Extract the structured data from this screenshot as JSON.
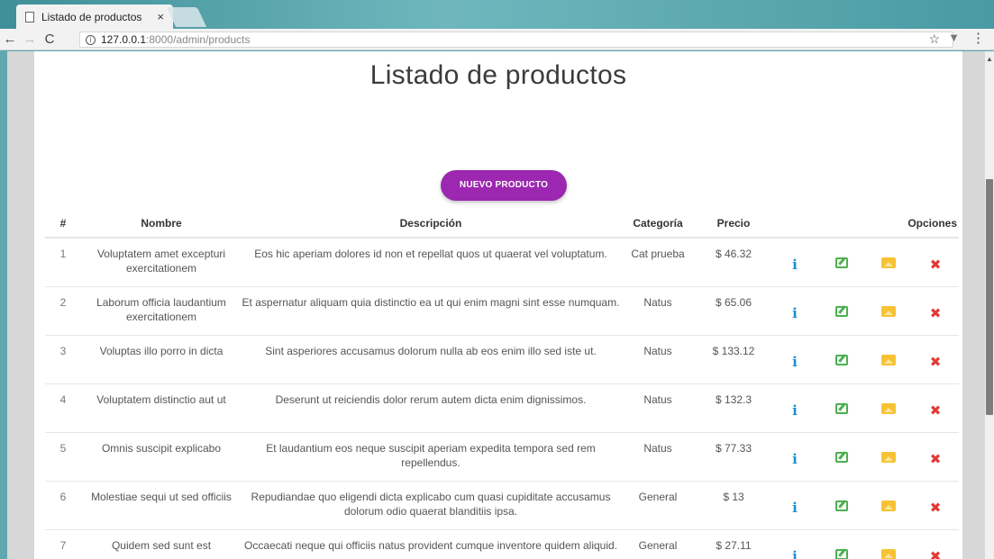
{
  "browser": {
    "tab_title": "Listado de productos",
    "tab_close": "×",
    "url_host": "127.0.0.1",
    "url_path": ":8000/admin/products",
    "back": "←",
    "forward": "→",
    "reload": "C",
    "info": "i",
    "star": "☆",
    "extension": "▼",
    "menu": "⋮"
  },
  "page": {
    "title": "Listado de productos",
    "new_button": "NUEVO PRODUCTO"
  },
  "table": {
    "headers": {
      "num": "#",
      "name": "Nombre",
      "description": "Descripción",
      "category": "Categoría",
      "price": "Precio",
      "options": "Opciones"
    },
    "rows": [
      {
        "num": "1",
        "name": "Voluptatem amet excepturi exercitationem",
        "description": "Eos hic aperiam dolores id non et repellat quos ut quaerat vel voluptatum.",
        "category": "Cat prueba",
        "price": "$ 46.32"
      },
      {
        "num": "2",
        "name": "Laborum officia laudantium exercitationem",
        "description": "Et aspernatur aliquam quia distinctio ea ut qui enim magni sint esse numquam.",
        "category": "Natus",
        "price": "$ 65.06"
      },
      {
        "num": "3",
        "name": "Voluptas illo porro in dicta",
        "description": "Sint asperiores accusamus dolorum nulla ab eos enim illo sed iste ut.",
        "category": "Natus",
        "price": "$ 133.12"
      },
      {
        "num": "4",
        "name": "Voluptatem distinctio aut ut",
        "description": "Deserunt ut reiciendis dolor rerum autem dicta enim dignissimos.",
        "category": "Natus",
        "price": "$ 132.3"
      },
      {
        "num": "5",
        "name": "Omnis suscipit explicabo",
        "description": "Et laudantium eos neque suscipit aperiam expedita tempora sed rem repellendus.",
        "category": "Natus",
        "price": "$ 77.33"
      },
      {
        "num": "6",
        "name": "Molestiae sequi ut sed officiis",
        "description": "Repudiandae quo eligendi dicta explicabo cum quasi cupiditate accusamus dolorum odio quaerat blanditiis ipsa.",
        "category": "General",
        "price": "$ 13"
      },
      {
        "num": "7",
        "name": "Quidem sed sunt est",
        "description": "Occaecati neque qui officiis natus provident cumque inventore quidem aliquid.",
        "category": "General",
        "price": "$ 27.11"
      }
    ],
    "icons": {
      "info": "i",
      "delete": "✖"
    },
    "colors": {
      "info": "#1a8fd1",
      "edit": "#4caf50",
      "image": "#f7c233",
      "delete": "#e53935",
      "button": "#9c27b0"
    }
  }
}
